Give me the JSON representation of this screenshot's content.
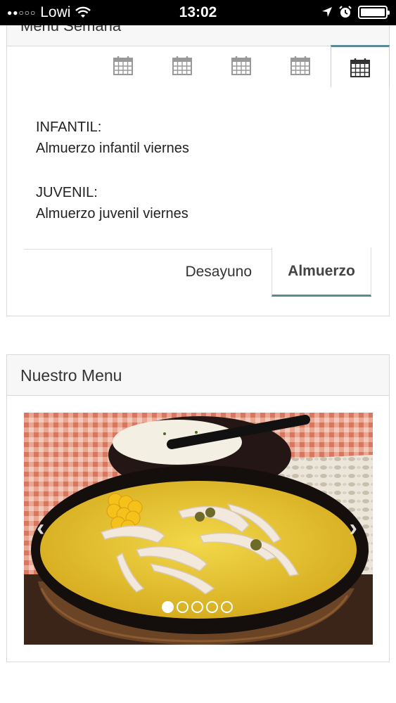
{
  "status_bar": {
    "carrier": "Lowi",
    "time": "13:02"
  },
  "menu_semana": {
    "title": "Menu Semana",
    "day_tabs": [
      "calendar-icon",
      "calendar-icon",
      "calendar-icon",
      "calendar-icon",
      "calendar-icon"
    ],
    "active_day_index": 4,
    "entries": [
      {
        "label": "INFANTIL:",
        "text": "Almuerzo infantil viernes"
      },
      {
        "label": "JUVENIL:",
        "text": "Almuerzo juvenil viernes"
      }
    ],
    "meal_tabs": [
      "Desayuno",
      "Almuerzo"
    ],
    "active_meal": "Almuerzo"
  },
  "nuestro_menu": {
    "title": "Nuestro Menu",
    "slide_count": 5,
    "active_slide": 0
  },
  "colors": {
    "accent": "#5a8a93"
  }
}
